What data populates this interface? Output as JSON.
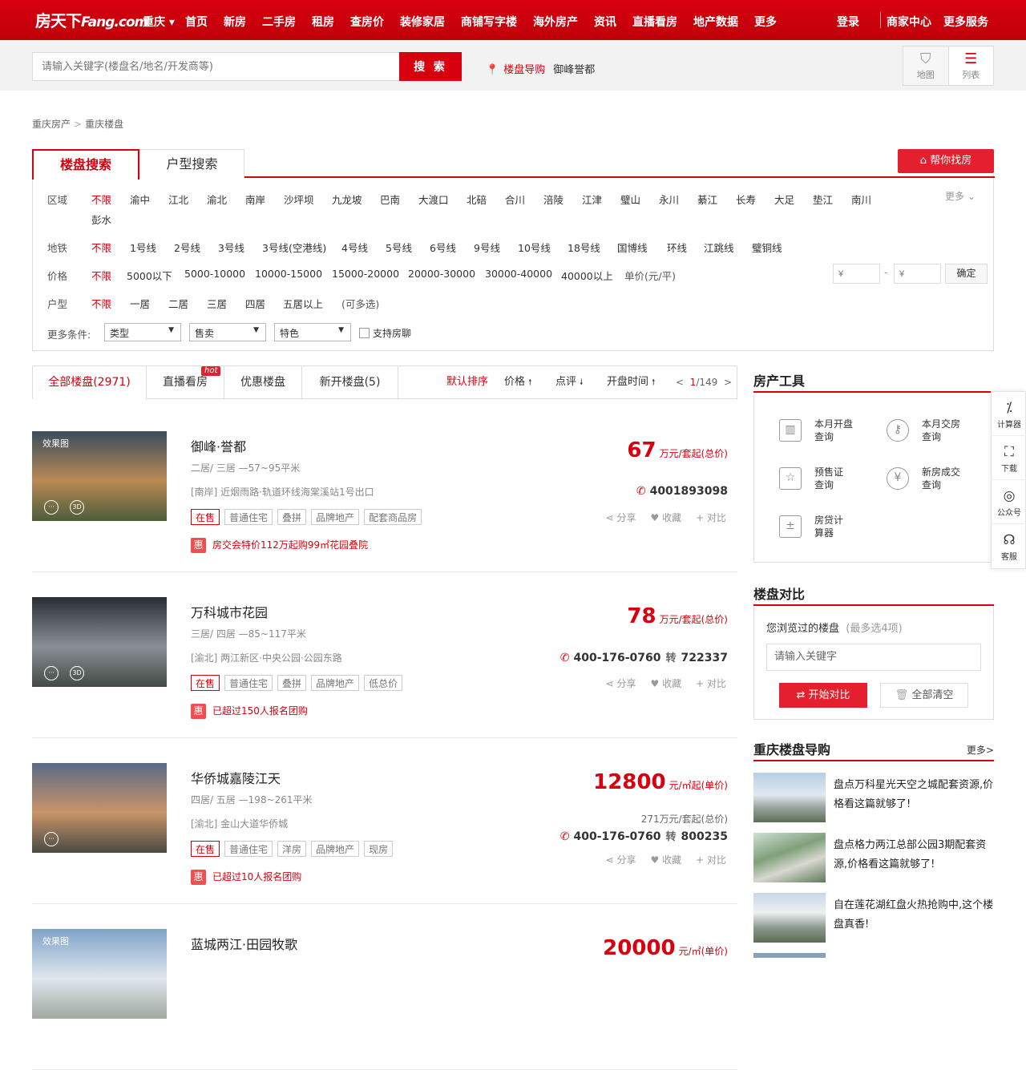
{
  "brand": {
    "logo_cn": "房天下",
    "logo_en": "Fang.com",
    "city": "重庆"
  },
  "nav": [
    "首页",
    "新房",
    "二手房",
    "租房",
    "查房价",
    "装修家居",
    "商铺写字楼",
    "海外房产",
    "资讯",
    "直播看房",
    "地产数据",
    "更多"
  ],
  "user": {
    "login": "登录",
    "merchant": "商家中心",
    "more_services": "更多服务"
  },
  "search": {
    "placeholder": "请输入关键字(楼盘名/地名/开发商等)",
    "button": "搜 索",
    "guide_label": "楼盘导购",
    "guide_name": "御峰誉都"
  },
  "view": {
    "map": "地图",
    "list": "列表"
  },
  "breadcrumb": [
    "重庆房产",
    "重庆楼盘"
  ],
  "filter": {
    "tabs": [
      "楼盘搜索",
      "户型搜索"
    ],
    "help_btn": "帮你找房",
    "more": "更多",
    "area": {
      "label": "区域",
      "items": [
        "不限",
        "渝中",
        "江北",
        "渝北",
        "南岸",
        "沙坪坝",
        "九龙坡",
        "巴南",
        "大渡口",
        "北碚",
        "合川",
        "涪陵",
        "江津",
        "璧山",
        "永川",
        "綦江",
        "长寿",
        "大足",
        "垫江",
        "南川",
        "彭水"
      ]
    },
    "subway": {
      "label": "地铁",
      "items": [
        "不限",
        "1号线",
        "2号线",
        "3号线",
        "3号线(空港线)",
        "4号线",
        "5号线",
        "6号线",
        "9号线",
        "10号线",
        "18号线",
        "国博线",
        "环线",
        "江跳线",
        "璧铜线"
      ]
    },
    "price": {
      "label": "价格",
      "items": [
        "不限",
        "5000以下",
        "5000-10000",
        "10000-15000",
        "15000-20000",
        "20000-30000",
        "30000-40000",
        "40000以上",
        "单价(元/平)"
      ],
      "min_placeholder": "¥",
      "max_placeholder": "¥",
      "dash": "-",
      "confirm": "确定"
    },
    "room": {
      "label": "户型",
      "items": [
        "不限",
        "一居",
        "二居",
        "三居",
        "四居",
        "五居以上",
        "(可多选)"
      ]
    },
    "more_cond": {
      "label": "更多条件:",
      "selects": [
        "类型",
        "售卖",
        "特色"
      ],
      "checkbox": "支持房聊"
    }
  },
  "list_tabs": {
    "all": "全部楼盘(2971)",
    "live": "直播看房",
    "hot": "hot",
    "discount": "优惠楼盘",
    "new": "新开楼盘(5)"
  },
  "sort": {
    "default": "默认排序",
    "price": "价格",
    "review": "点评",
    "open": "开盘时间",
    "arrow_up": "🠕",
    "arrow_down": "🠗"
  },
  "pager": {
    "prev": "<",
    "current": "1",
    "total": "/149",
    "next": ">"
  },
  "actions": {
    "share": "分享",
    "fav": "收藏",
    "compare": "对比"
  },
  "listings": [
    {
      "name": "御峰·誉都",
      "layout": "二居/ 三居 —57~95平米",
      "addr": "[南岸] 近烟雨路·轨道环线海棠溪站1号出口",
      "tags": [
        "在售",
        "普通住宅",
        "叠拼",
        "品牌地产",
        "配套商品房"
      ],
      "price": "67",
      "unit": "万元/套起(总价)",
      "phone": "4001893098",
      "ext": "",
      "promo": "房交会特价112万起购99㎡花园叠院",
      "img_label": "效果图",
      "colors": [
        "#3a4c5e",
        "#b98a55",
        "#4d5c3a"
      ]
    },
    {
      "name": "万科城市花园",
      "layout": "三居/ 四居 —85~117平米",
      "addr": "[渝北] 两江新区·中央公园·公园东路",
      "tags": [
        "在售",
        "普通住宅",
        "叠拼",
        "品牌地产",
        "低总价"
      ],
      "price": "78",
      "unit": "万元/套起(总价)",
      "phone": "400-176-0760",
      "ext": "722337",
      "promo": "已超过150人报名团购",
      "img_label": "",
      "colors": [
        "#2a2e34",
        "#8a8f96",
        "#444a44"
      ]
    },
    {
      "name": "华侨城嘉陵江天",
      "layout": "四居/ 五居 —198~261平米",
      "addr": "[渝北] 金山大道华侨城",
      "tags": [
        "在售",
        "普通住宅",
        "洋房",
        "品牌地产",
        "现房"
      ],
      "price": "12800",
      "unit": "元/㎡起(单价)",
      "subprice": "271万元/套起(总价)",
      "phone": "400-176-0760",
      "ext": "800235",
      "promo": "已超过10人报名团购",
      "img_label": "",
      "colors": [
        "#5a6a86",
        "#c99468",
        "#4a4a44"
      ]
    },
    {
      "name": "蓝城两江·田园牧歌",
      "price": "20000",
      "unit": "元/㎡(单价)",
      "img_label": "效果图",
      "colors": [
        "#7ea3c6",
        "#dfe7ef",
        "#a0a8a0"
      ]
    }
  ],
  "zhuan": "转",
  "tools": {
    "title": "房产工具",
    "items": [
      "本月开盘查询",
      "本月交房查询",
      "预售证查询",
      "新房成交查询",
      "房贷计算器"
    ]
  },
  "compare": {
    "title": "楼盘对比",
    "hint": "您浏览过的楼盘",
    "hint_sub": "(最多选4项)",
    "placeholder": "请输入关键字",
    "start": "开始对比",
    "clear": "全部清空"
  },
  "guide_news": {
    "title": "重庆楼盘导购",
    "more": "更多",
    "items": [
      "盘点万科星光天空之城配套资源,价格看这篇就够了!",
      "盘点格力两江总部公园3期配套资源,价格看这篇就够了!",
      "自在莲花湖红盘火热抢购中,这个楼盘真香!"
    ]
  },
  "rightbar": [
    "计算器",
    "下载",
    "公众号",
    "客服"
  ],
  "accent": "#d8000f"
}
